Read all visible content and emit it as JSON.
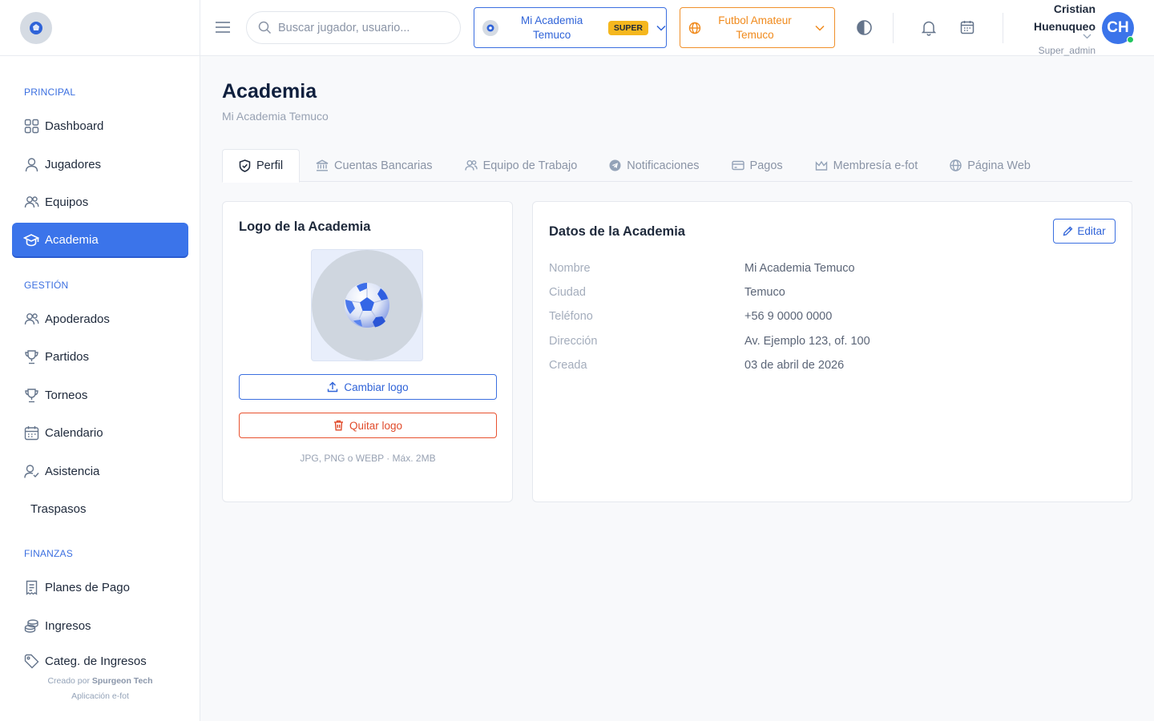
{
  "header": {
    "search_placeholder": "Buscar jugador, usuario...",
    "academy_line1": "Mi Academia",
    "academy_line2": "Temuco",
    "academy_badge": "SUPER",
    "league_line1": "Futbol Amateur",
    "league_line2": "Temuco",
    "user_first": "Cristian",
    "user_last": "Huenuqueo",
    "user_role": "Super_admin",
    "avatar_initials": "CH"
  },
  "sidebar": {
    "sections": [
      "PRINCIPAL",
      "GESTIÓN",
      "FINANZAS"
    ],
    "items": [
      {
        "label": "Dashboard",
        "icon": "grid-icon"
      },
      {
        "label": "Jugadores",
        "icon": "user-icon"
      },
      {
        "label": "Equipos",
        "icon": "users-icon"
      },
      {
        "label": "Academia",
        "icon": "graduation-cap-icon"
      },
      {
        "label": "Apoderados",
        "icon": "users-icon"
      },
      {
        "label": "Partidos",
        "icon": "trophy-icon"
      },
      {
        "label": "Torneos",
        "icon": "trophy-icon"
      },
      {
        "label": "Calendario",
        "icon": "calendar-icon"
      },
      {
        "label": "Asistencia",
        "icon": "user-check-icon"
      },
      {
        "label": "Traspasos",
        "icon": ""
      },
      {
        "label": "Planes de Pago",
        "icon": "receipt-icon"
      },
      {
        "label": "Ingresos",
        "icon": "coins-icon"
      },
      {
        "label": "Categ. de Ingresos",
        "icon": "tag-icon"
      }
    ],
    "footer_prefix": "Creado por",
    "footer_brand": "Spurgeon Tech",
    "footer_app": "Aplicación e-fot"
  },
  "page": {
    "title": "Academia",
    "subtitle": "Mi Academia Temuco"
  },
  "tabs": [
    {
      "label": "Perfil",
      "icon": "shield-check-icon"
    },
    {
      "label": "Cuentas Bancarias",
      "icon": "bank-icon"
    },
    {
      "label": "Equipo de Trabajo",
      "icon": "users-icon"
    },
    {
      "label": "Notificaciones",
      "icon": "telegram-icon"
    },
    {
      "label": "Pagos",
      "icon": "credit-card-icon"
    },
    {
      "label": "Membresía e-fot",
      "icon": "crown-icon"
    },
    {
      "label": "Página Web",
      "icon": "globe-icon"
    }
  ],
  "logo_card": {
    "title": "Logo de la Academia",
    "change_label": "Cambiar logo",
    "remove_label": "Quitar logo",
    "hint": "JPG, PNG o WEBP · Máx. 2MB"
  },
  "data_card": {
    "title": "Datos de la Academia",
    "edit_label": "Editar",
    "rows": [
      {
        "key": "Nombre",
        "value": "Mi Academia Temuco"
      },
      {
        "key": "Ciudad",
        "value": "Temuco"
      },
      {
        "key": "Teléfono",
        "value": "+56 9 0000 0000"
      },
      {
        "key": "Dirección",
        "value": "Av. Ejemplo 123, of. 100"
      },
      {
        "key": "Creada",
        "value": "03 de abril de 2026"
      }
    ]
  },
  "colors": {
    "primary": "#3b74ea",
    "orange": "#f08a1c",
    "danger": "#e04a2a",
    "badge": "#f5b71e"
  }
}
